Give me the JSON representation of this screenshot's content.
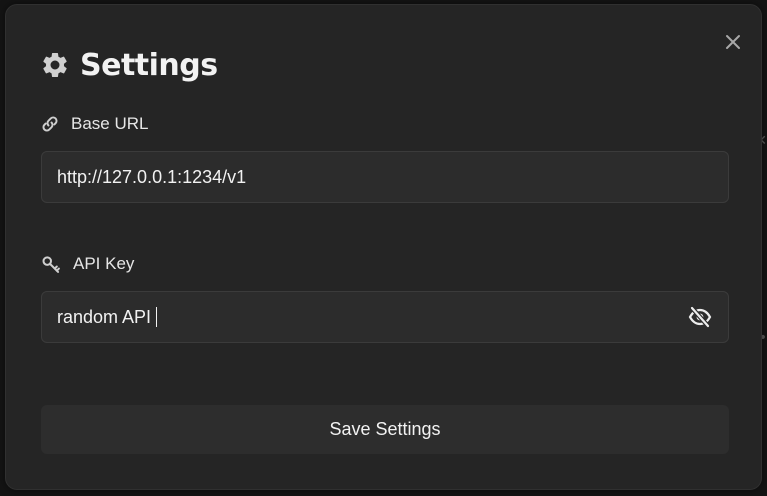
{
  "dialog": {
    "title": "Settings",
    "close_icon": "close-icon",
    "title_icon": "gear-icon"
  },
  "base_url": {
    "label": "Base URL",
    "icon": "link-icon",
    "value": "http://127.0.0.1:1234/v1"
  },
  "api_key": {
    "label": "API Key",
    "icon": "key-icon",
    "value": "random API",
    "visibility_icon": "eye-slash-icon"
  },
  "actions": {
    "save_label": "Save Settings"
  },
  "colors": {
    "modal_bg": "#252525",
    "input_bg": "#2c2c2c",
    "button_bg": "#2d2d2d",
    "text": "#f2f2f2"
  }
}
